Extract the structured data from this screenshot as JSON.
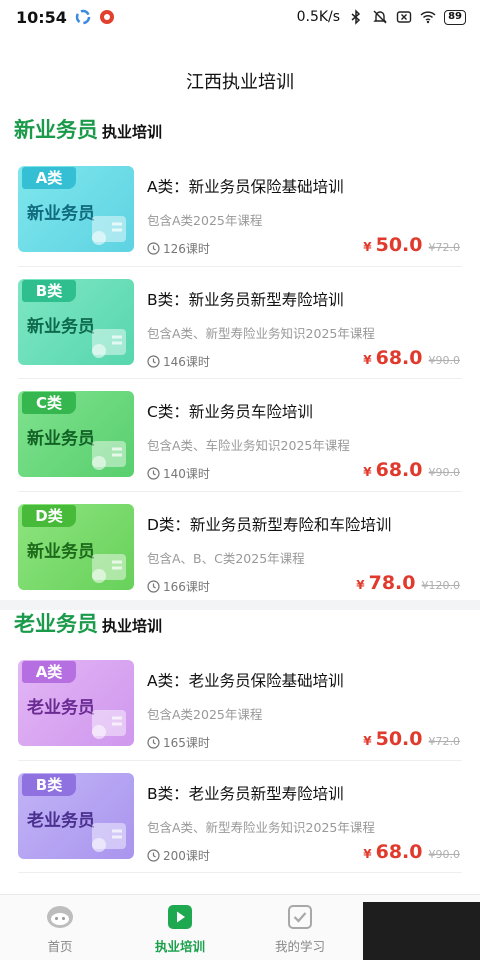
{
  "status_bar": {
    "time": "10:54",
    "net_speed": "0.5K/s",
    "battery": "89"
  },
  "header": {
    "title": "江西执业培训"
  },
  "sections": [
    {
      "title": "新业务员",
      "subtitle": "执业培训",
      "courses": [
        {
          "tag": "A类",
          "thumb_name": "新业务员",
          "title": "A类：新业务员保险基础培训",
          "desc": "包含A类2025年课程",
          "hours": "126课时",
          "currency": "¥",
          "price": "50.0",
          "old_price": "¥72.0",
          "theme": "cyan"
        },
        {
          "tag": "B类",
          "thumb_name": "新业务员",
          "title": "B类：新业务员新型寿险培训",
          "desc": "包含A类、新型寿险业务知识2025年课程",
          "hours": "146课时",
          "currency": "¥",
          "price": "68.0",
          "old_price": "¥90.0",
          "theme": "teal"
        },
        {
          "tag": "C类",
          "thumb_name": "新业务员",
          "title": "C类：新业务员车险培训",
          "desc": "包含A类、车险业务知识2025年课程",
          "hours": "140课时",
          "currency": "¥",
          "price": "68.0",
          "old_price": "¥90.0",
          "theme": "green"
        },
        {
          "tag": "D类",
          "thumb_name": "新业务员",
          "title": "D类：新业务员新型寿险和车险培训",
          "desc": "包含A、B、C类2025年课程",
          "hours": "166课时",
          "currency": "¥",
          "price": "78.0",
          "old_price": "¥120.0",
          "theme": "lime"
        }
      ]
    },
    {
      "title": "老业务员",
      "subtitle": "执业培训",
      "courses": [
        {
          "tag": "A类",
          "thumb_name": "老业务员",
          "title": "A类：老业务员保险基础培训",
          "desc": "包含A类2025年课程",
          "hours": "165课时",
          "currency": "¥",
          "price": "50.0",
          "old_price": "¥72.0",
          "theme": "violet"
        },
        {
          "tag": "B类",
          "thumb_name": "老业务员",
          "title": "B类：老业务员新型寿险培训",
          "desc": "包含A类、新型寿险业务知识2025年课程",
          "hours": "200课时",
          "currency": "¥",
          "price": "68.0",
          "old_price": "¥90.0",
          "theme": "indigo"
        }
      ]
    }
  ],
  "bottom_nav": {
    "items": [
      {
        "label": "首页",
        "icon": "home-face-icon"
      },
      {
        "label": "执业培训",
        "icon": "play-icon",
        "active": true
      },
      {
        "label": "我的学习",
        "icon": "checkbox-icon"
      }
    ]
  },
  "colors": {
    "brand_green": "#1a9a4a",
    "price_red": "#e03a2d"
  }
}
